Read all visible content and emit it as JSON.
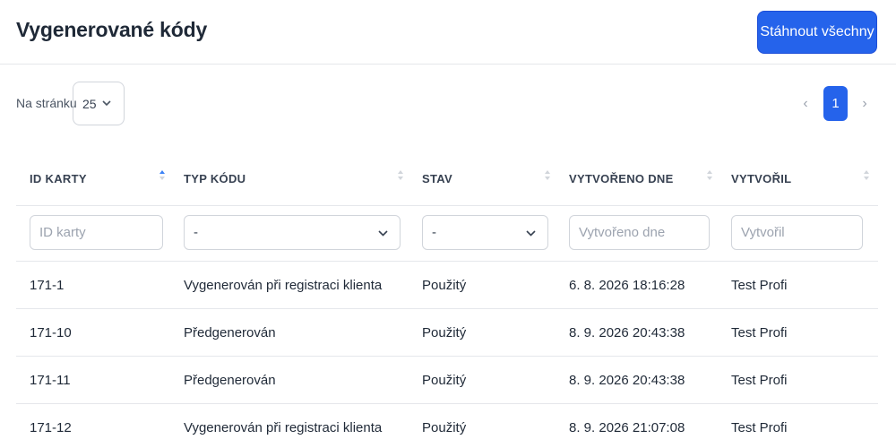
{
  "header": {
    "title": "Vygenerované kódy",
    "download_all_label": "Stáhnout všechny"
  },
  "pagination": {
    "per_page_label": "Na stránku",
    "per_page_value": "25",
    "current_page": "1",
    "prev_icon": "chevron-left-icon",
    "next_icon": "chevron-right-icon"
  },
  "table": {
    "columns": [
      {
        "label": "ID KARTY",
        "sorted": "asc"
      },
      {
        "label": "TYP KÓDU",
        "sorted": "none"
      },
      {
        "label": "STAV",
        "sorted": "none"
      },
      {
        "label": "VYTVOŘENO DNE",
        "sorted": "none"
      },
      {
        "label": "VYTVOŘIL",
        "sorted": "none"
      }
    ],
    "filters": {
      "card_id_placeholder": "ID karty",
      "code_type_value": "-",
      "status_value": "-",
      "created_placeholder": "Vytvořeno dne",
      "creator_placeholder": "Vytvořil"
    },
    "rows": [
      {
        "card_id": "171-1",
        "code_type": "Vygenerován při registraci klienta",
        "status": "Použitý",
        "created": "6. 8. 2026 18:16:28",
        "creator": "Test Profi"
      },
      {
        "card_id": "171-10",
        "code_type": "Předgenerován",
        "status": "Použitý",
        "created": "8. 9. 2026 20:43:38",
        "creator": "Test Profi"
      },
      {
        "card_id": "171-11",
        "code_type": "Předgenerován",
        "status": "Použitý",
        "created": "8. 9. 2026 20:43:38",
        "creator": "Test Profi"
      },
      {
        "card_id": "171-12",
        "code_type": "Vygenerován při registraci klienta",
        "status": "Použitý",
        "created": "8. 9. 2026 21:07:08",
        "creator": "Test Profi"
      }
    ]
  },
  "colors": {
    "primary": "#2563eb",
    "border": "#e5e7eb",
    "sort_active": "#3b82f6"
  }
}
